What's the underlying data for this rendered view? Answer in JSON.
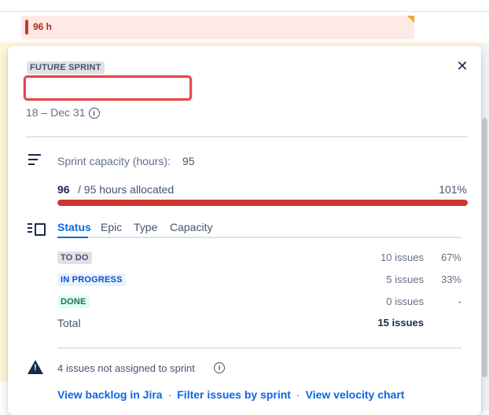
{
  "background_row": {
    "hours": "96 h"
  },
  "sprint": {
    "status_lozenge": "FUTURE SPRINT",
    "name_value": "",
    "dates": "18 – Dec 31",
    "close_glyph": "✕"
  },
  "capacity": {
    "label": "Sprint capacity (hours):",
    "value": "95",
    "allocated_used": "96",
    "allocated_rest": "/ 95 hours allocated",
    "percent": "101%",
    "progress_fraction": 1.0
  },
  "tabs": [
    {
      "label": "Status",
      "active": true
    },
    {
      "label": "Epic",
      "active": false
    },
    {
      "label": "Type",
      "active": false
    },
    {
      "label": "Capacity",
      "active": false
    }
  ],
  "status_rows": [
    {
      "status": "TO DO",
      "count": "10 issues",
      "percent": "67%",
      "color": "grey"
    },
    {
      "status": "IN PROGRESS",
      "count": "5 issues",
      "percent": "33%",
      "color": "blue"
    },
    {
      "status": "DONE",
      "count": "0 issues",
      "percent": "-",
      "color": "green"
    }
  ],
  "total": {
    "label": "Total",
    "count": "15 issues"
  },
  "warning": {
    "text": "4 issues not assigned to sprint",
    "icon": "warning-icon"
  },
  "links": [
    {
      "label": "View backlog in Jira"
    },
    {
      "label": "Filter issues by sprint"
    },
    {
      "label": "View velocity chart"
    }
  ],
  "link_separator": "·",
  "colors": {
    "accent": "#0c66e4",
    "danger": "#c9372c",
    "text": "#172b4d",
    "muted": "#626f86"
  }
}
